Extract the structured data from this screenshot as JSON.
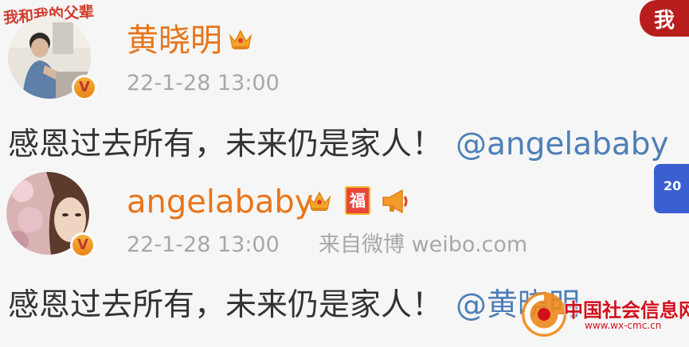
{
  "corner_art": {
    "left_text": "我和我的父辈",
    "right_text": "我"
  },
  "post1": {
    "username": "黄晓明",
    "timestamp": "22-1-28 13:00",
    "content": "感恩过去所有，未来仍是家人！",
    "mention": "@angelababy"
  },
  "post2": {
    "username": "angelababy",
    "timestamp": "22-1-28 13:00",
    "source": "来自微博 weibo.com",
    "content": "感恩过去所有，未来仍是家人！",
    "mention": "@黄晓明",
    "badge_fu": "福",
    "corner_badge": "20"
  },
  "watermark": {
    "title": "中国社会信息网",
    "url": "www.wx-cmc.cn"
  },
  "icons": [
    "crown-icon",
    "verified-badge-icon",
    "fu-badge-icon",
    "megaphone-icon"
  ],
  "colors": {
    "username": "#e8751a",
    "mention": "#4e7fb6",
    "meta": "#a8a8a8",
    "watermark": "#d0101c"
  }
}
